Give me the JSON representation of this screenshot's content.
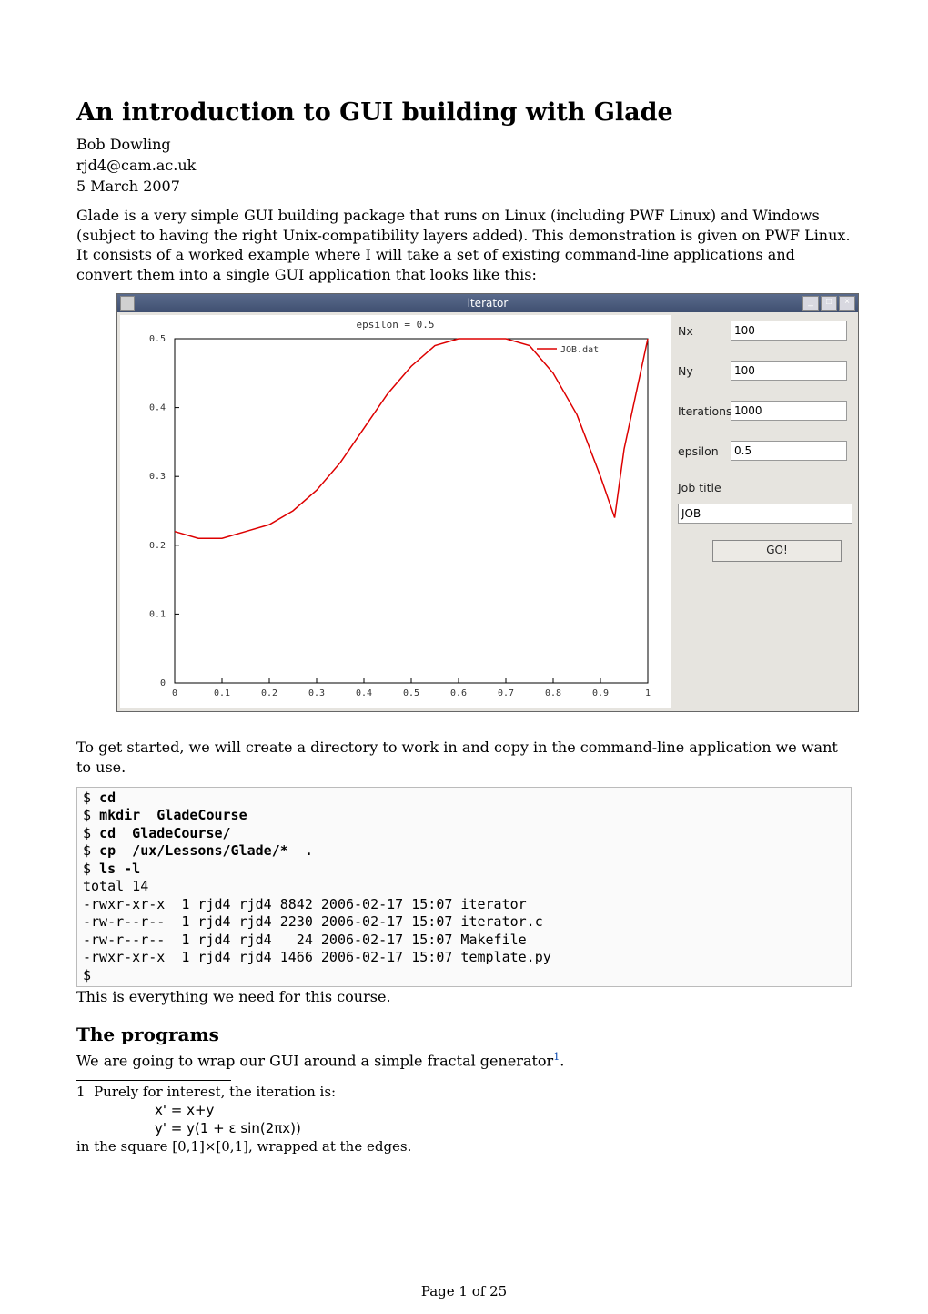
{
  "doc": {
    "title": "An introduction to GUI building with Glade",
    "author": "Bob Dowling",
    "email": "rjd4@cam.ac.uk",
    "date": "5 March 2007",
    "intro_para": "Glade is a very simple GUI building package that runs on Linux (including PWF Linux) and Windows (subject to having the right Unix-compatibility layers added). This demonstration is given on PWF Linux. It consists of a worked example where I will take a set of existing command-line applications and convert them into a single GUI application that looks like this:",
    "after_screenshot": "To get started, we will create a directory to work in and copy in the command-line application we want to use.",
    "after_terminal": "This is everything we need for this course.",
    "section2_heading": "The programs",
    "section2_text": "We are going to wrap our GUI around a simple fractal generator",
    "footnote_ref": "1",
    "section2_period": ".",
    "footnote": {
      "num": "1",
      "lead": "Purely for interest, the iteration is:",
      "eq1": "x' = x+y",
      "eq2": "y' = y(1 + ε sin(2πx))",
      "tail": "in the square [0,1]×[0,1], wrapped at the edges."
    },
    "page_num": "Page 1 of 25"
  },
  "app_window": {
    "title": "iterator",
    "winbtn_min": "_",
    "winbtn_max": "□",
    "winbtn_close": "×",
    "plot_title": "epsilon = 0.5",
    "legend": "JOB.dat",
    "x_ticks": [
      "0",
      "0.1",
      "0.2",
      "0.3",
      "0.4",
      "0.5",
      "0.6",
      "0.7",
      "0.8",
      "0.9",
      "1"
    ],
    "y_ticks": [
      "0",
      "0.1",
      "0.2",
      "0.3",
      "0.4",
      "0.5"
    ],
    "fields": {
      "nx_label": "Nx",
      "nx_value": "100",
      "ny_label": "Ny",
      "ny_value": "100",
      "iters_label": "Iterations",
      "iters_value": "1000",
      "eps_label": "epsilon",
      "eps_value": "0.5",
      "jobtitle_label": "Job title",
      "jobtitle_value": "JOB",
      "go_label": "GO!"
    }
  },
  "chart_data": {
    "type": "line",
    "title": "epsilon = 0.5",
    "xlabel": "",
    "ylabel": "",
    "xlim": [
      0,
      1
    ],
    "ylim": [
      0,
      0.5
    ],
    "legend": [
      "JOB.dat"
    ],
    "series": [
      {
        "name": "JOB.dat",
        "x": [
          0.0,
          0.05,
          0.1,
          0.15,
          0.2,
          0.25,
          0.3,
          0.35,
          0.4,
          0.45,
          0.5,
          0.55,
          0.6,
          0.65,
          0.7,
          0.75,
          0.8,
          0.85,
          0.9,
          0.93,
          0.95,
          1.0
        ],
        "y": [
          0.22,
          0.21,
          0.21,
          0.22,
          0.23,
          0.25,
          0.28,
          0.32,
          0.37,
          0.42,
          0.46,
          0.49,
          0.5,
          0.5,
          0.5,
          0.49,
          0.45,
          0.39,
          0.3,
          0.24,
          0.34,
          0.5
        ]
      }
    ]
  },
  "terminal": {
    "lines": [
      {
        "prompt": "$ ",
        "cmd": "cd",
        "rest": ""
      },
      {
        "prompt": "$ ",
        "cmd": "mkdir  GladeCourse",
        "rest": ""
      },
      {
        "prompt": "$ ",
        "cmd": "cd  GladeCourse/",
        "rest": ""
      },
      {
        "prompt": "$ ",
        "cmd": "cp  /ux/Lessons/Glade/*  .",
        "rest": ""
      },
      {
        "prompt": "$ ",
        "cmd": "ls -l",
        "rest": ""
      },
      {
        "plain": "total 14"
      },
      {
        "plain": "-rwxr-xr-x  1 rjd4 rjd4 8842 2006-02-17 15:07 iterator"
      },
      {
        "plain": "-rw-r--r--  1 rjd4 rjd4 2230 2006-02-17 15:07 iterator.c"
      },
      {
        "plain": "-rw-r--r--  1 rjd4 rjd4   24 2006-02-17 15:07 Makefile"
      },
      {
        "plain": "-rwxr-xr-x  1 rjd4 rjd4 1466 2006-02-17 15:07 template.py"
      },
      {
        "prompt": "$",
        "cmd": "",
        "rest": ""
      }
    ]
  }
}
